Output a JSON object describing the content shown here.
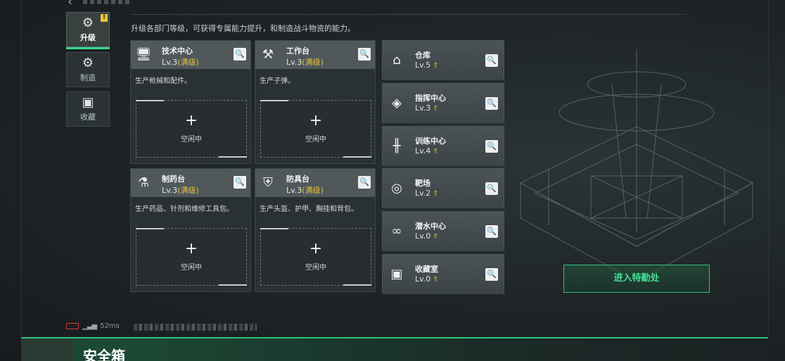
{
  "header": {
    "back_icon": "chevron-left-icon"
  },
  "side_tabs": [
    {
      "label": "升级",
      "icon": "upgrade-gear-icon",
      "badge": "!"
    },
    {
      "label": "制造",
      "icon": "manufacture-gears-icon"
    },
    {
      "label": "收藏",
      "icon": "collection-icon"
    }
  ],
  "description": "升级各部门等级，可获得专属能力提升，和制造战斗物资的能力。",
  "departments": [
    {
      "name": "技术中心",
      "level": "Lv.3",
      "max": "(满级)",
      "desc": "生产枪械和配件。",
      "icon": "computer-icon",
      "slot_plus": "+",
      "slot_label": "空闲中"
    },
    {
      "name": "工作台",
      "level": "Lv.3",
      "max": "(满级)",
      "desc": "生产子弹。",
      "icon": "tools-icon",
      "slot_plus": "+",
      "slot_label": "空闲中"
    },
    {
      "name": "制药台",
      "level": "Lv.3",
      "max": "(满级)",
      "desc": "生产药品、针剂和维修工具包。",
      "icon": "flask-icon",
      "slot_plus": "+",
      "slot_label": "空闲中"
    },
    {
      "name": "防具台",
      "level": "Lv.3",
      "max": "(满级)",
      "desc": "生产头盔、护甲、胸挂和背包。",
      "icon": "armor-icon",
      "slot_plus": "+",
      "slot_label": "空闲中"
    }
  ],
  "facilities": [
    {
      "name": "仓库",
      "level": "Lv.5",
      "icon": "warehouse-icon"
    },
    {
      "name": "指挥中心",
      "level": "Lv.3",
      "icon": "command-chip-icon"
    },
    {
      "name": "训练中心",
      "level": "Lv.4",
      "icon": "dumbbell-icon"
    },
    {
      "name": "靶场",
      "level": "Lv.2",
      "icon": "target-icon"
    },
    {
      "name": "潜水中心",
      "level": "Lv.0",
      "icon": "goggles-icon"
    },
    {
      "name": "收藏室",
      "level": "Lv.0",
      "icon": "vault-icon"
    }
  ],
  "enter_button": "进入特勤处",
  "status": {
    "ping": "52ms"
  },
  "bottom_panel": {
    "title": "安全箱"
  },
  "colors": {
    "accent_green": "#35d98a",
    "max_gold": "#e6bf3a",
    "battery_red": "#d23b3b"
  }
}
